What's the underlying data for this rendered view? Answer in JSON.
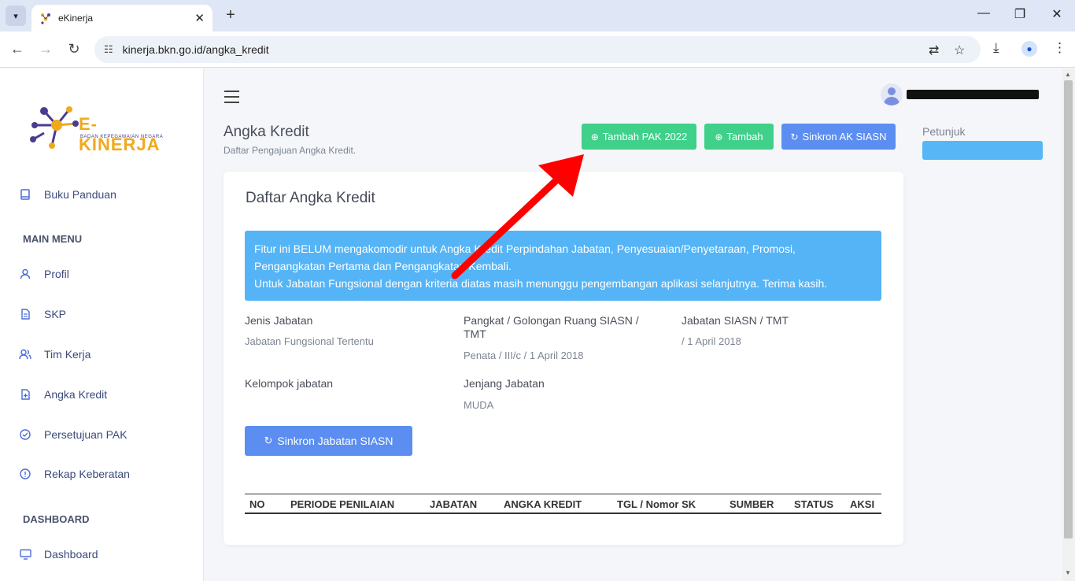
{
  "browser": {
    "tab_title": "eKinerja",
    "tab_close": "✕",
    "new_tab": "+",
    "url": "kinerja.bkn.go.id/angka_kredit",
    "min": "—",
    "restore": "❐",
    "close": "✕"
  },
  "sidebar": {
    "logo_text": "E-KINERJA",
    "logo_sub": "BADAN KEPEGAWAIAN NEGARA",
    "items": [
      {
        "label": "Buku Panduan",
        "icon": "book-icon"
      },
      {
        "label": "Profil",
        "icon": "user-icon"
      },
      {
        "label": "SKP",
        "icon": "document-icon"
      },
      {
        "label": "Tim Kerja",
        "icon": "users-icon"
      },
      {
        "label": "Angka Kredit",
        "icon": "file-plus-icon"
      },
      {
        "label": "Persetujuan PAK",
        "icon": "check-circle-icon"
      },
      {
        "label": "Rekap Keberatan",
        "icon": "alert-circle-icon"
      },
      {
        "label": "Dashboard",
        "icon": "monitor-icon"
      }
    ],
    "section_main": "MAIN MENU",
    "section_dashboard": "DASHBOARD"
  },
  "header": {
    "title": "Angka Kredit",
    "subtitle": "Daftar Pengajuan Angka Kredit.",
    "btn_tambah_pak": "Tambah PAK 2022",
    "btn_tambah": "Tambah",
    "btn_sinkron_ak": "Sinkron AK SIASN",
    "petunjuk": "Petunjuk"
  },
  "card": {
    "title": "Daftar Angka Kredit",
    "alert_line1": "Fitur ini BELUM mengakomodir untuk Angka Kredit Perpindahan Jabatan, Penyesuaian/Penyetaraan, Promosi,",
    "alert_line2": "Pengangkatan Pertama dan Pengangkatan Kembali.",
    "alert_line3": "Untuk Jabatan Fungsional dengan kriteria diatas masih menunggu pengembangan aplikasi selanjutnya. Terima kasih.",
    "jenis_label": "Jenis Jabatan",
    "jenis_val": "Jabatan Fungsional Tertentu",
    "pangkat_label_1": "Pangkat / Golongan Ruang SIASN /",
    "pangkat_label_2": "TMT",
    "pangkat_val": "Penata / III/c / 1 April 2018",
    "jabatan_label": "Jabatan SIASN / TMT",
    "jabatan_val": "/ 1 April 2018",
    "kelompok_label": "Kelompok jabatan",
    "jenjang_label": "Jenjang Jabatan",
    "jenjang_val": "MUDA",
    "btn_sinkron_jabatan": "Sinkron Jabatan SIASN"
  },
  "table": {
    "columns": [
      "NO",
      "PERIODE PENILAIAN",
      "JABATAN",
      "ANGKA KREDIT",
      "TGL / Nomor SK",
      "SUMBER",
      "STATUS",
      "AKSI"
    ]
  },
  "colors": {
    "accent_green": "#3fd08a",
    "accent_blue": "#5b8ef0",
    "alert_blue": "#55b4f6",
    "arrow_red": "#ff0000"
  }
}
